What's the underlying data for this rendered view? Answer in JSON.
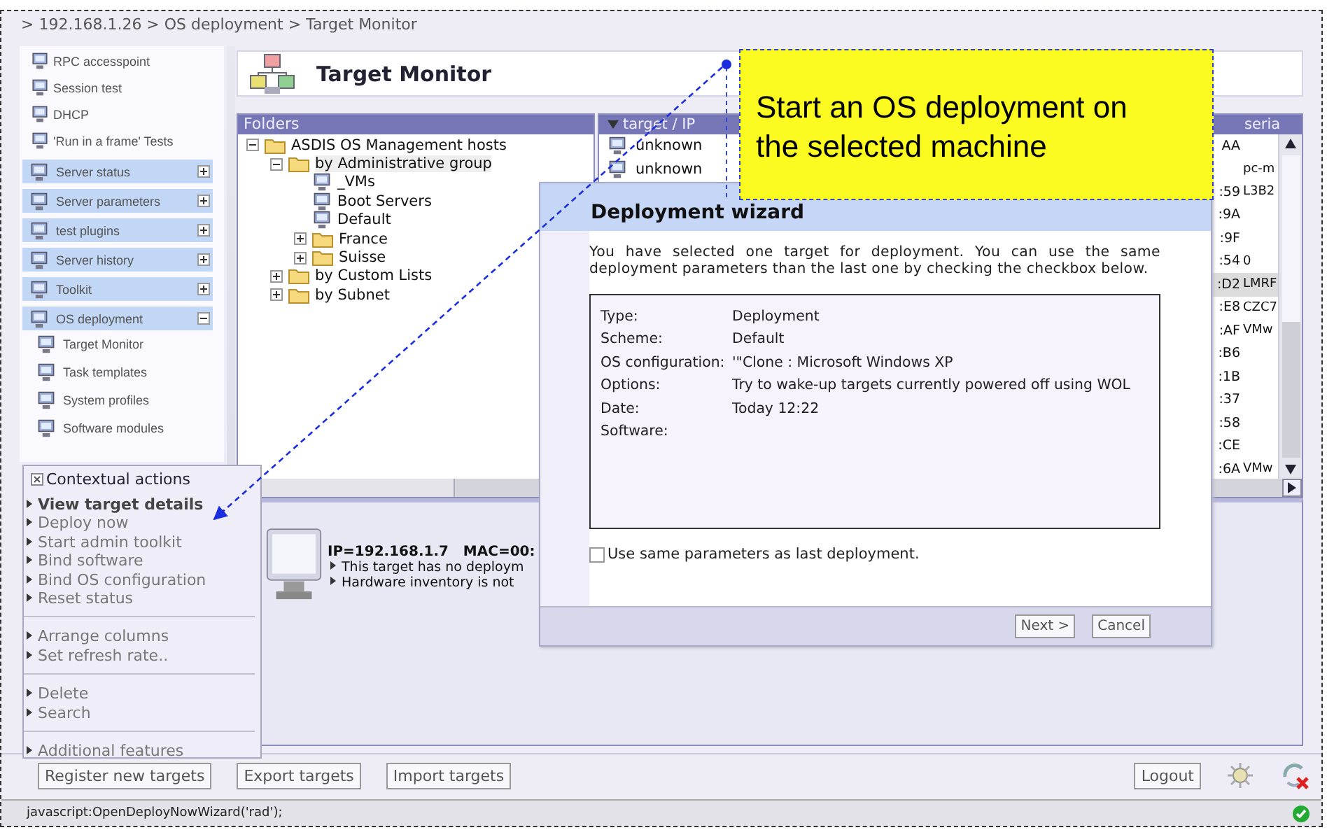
{
  "breadcrumb": "> 192.168.1.26 > OS deployment > Target Monitor",
  "sidebar": {
    "links": [
      "RPC accesspoint",
      "Session test",
      "DHCP",
      "'Run in a frame' Tests"
    ],
    "sections": [
      {
        "label": "Server status",
        "expanded": false
      },
      {
        "label": "Server parameters",
        "expanded": false
      },
      {
        "label": "test plugins",
        "expanded": false
      },
      {
        "label": "Server history",
        "expanded": false
      },
      {
        "label": "Toolkit",
        "expanded": false
      },
      {
        "label": "OS deployment",
        "expanded": true,
        "children": [
          "Target Monitor",
          "Task templates",
          "System profiles",
          "Software modules"
        ]
      }
    ]
  },
  "page_title": "Target Monitor",
  "folders": {
    "title": "Folders",
    "tree": [
      {
        "label": "ASDIS OS Management hosts",
        "kind": "folder",
        "expanded": true,
        "children": [
          {
            "label": "by Administrative group",
            "kind": "folder",
            "expanded": true,
            "selected": true,
            "children": [
              {
                "label": "_VMs",
                "kind": "group"
              },
              {
                "label": "Boot Servers",
                "kind": "group"
              },
              {
                "label": "Default",
                "kind": "group"
              },
              {
                "label": "France",
                "kind": "folder",
                "expanded": false
              },
              {
                "label": "Suisse",
                "kind": "folder",
                "expanded": false
              }
            ]
          },
          {
            "label": "by Custom Lists",
            "kind": "folder",
            "expanded": false
          },
          {
            "label": "by Subnet",
            "kind": "folder",
            "expanded": false
          }
        ]
      }
    ]
  },
  "targets": {
    "columns": [
      "target / IP",
      "seria"
    ],
    "rows": [
      {
        "target": "unknown",
        "mac": "AA",
        "selected": false
      },
      {
        "target": "unknown",
        "serial": "pc-m",
        "selected": false
      },
      {
        "mac": ":59",
        "serial": "L3B2",
        "selected": false
      },
      {
        "mac": ":9A",
        "selected": false
      },
      {
        "mac": ":9F",
        "selected": false
      },
      {
        "mac": ":54",
        "serial": "0",
        "selected": false
      },
      {
        "mac": ":D2",
        "serial": "LMRF",
        "selected": true
      },
      {
        "mac": ":E8",
        "serial": "CZC7",
        "selected": false
      },
      {
        "mac": ":AF",
        "serial": "VMw",
        "selected": false
      },
      {
        "mac": ":B6",
        "selected": false
      },
      {
        "mac": ":1B",
        "selected": false
      },
      {
        "mac": ":37",
        "selected": false
      },
      {
        "mac": ":58",
        "selected": false
      },
      {
        "mac": ":CE",
        "selected": false
      },
      {
        "mac": ":6A",
        "serial": "VMw",
        "selected": false
      }
    ]
  },
  "details": {
    "heading": "IP=192.168.1.7   MAC=00:",
    "lines": [
      "This target has no deploym",
      "Hardware inventory is not"
    ]
  },
  "context_menu": {
    "title": "Contextual actions",
    "groups": [
      [
        {
          "label": "View target details",
          "bold": true
        },
        {
          "label": "Deploy now",
          "bold": false
        },
        {
          "label": "Start admin toolkit",
          "bold": false
        },
        {
          "label": "Bind software",
          "bold": false
        },
        {
          "label": "Bind OS configuration",
          "bold": false
        },
        {
          "label": "Reset status",
          "bold": false
        }
      ],
      [
        {
          "label": "Arrange columns",
          "bold": false
        },
        {
          "label": "Set refresh rate..",
          "bold": false
        }
      ],
      [
        {
          "label": "Delete",
          "bold": false
        },
        {
          "label": "Search",
          "bold": false
        }
      ],
      [
        {
          "label": "Additional features",
          "bold": false
        }
      ]
    ]
  },
  "buttons": [
    "Register new targets",
    "Export targets",
    "Import targets"
  ],
  "logout": "Logout",
  "status_bar": "javascript:OpenDeployNowWizard('rad');",
  "dialog": {
    "title": "Deployment wizard",
    "message": "You have selected one target for deployment. You can use the same deployment parameters than the last one by checking the checkbox below.",
    "info": [
      {
        "label": "Type:",
        "value": "Deployment"
      },
      {
        "label": "Scheme:",
        "value": "Default"
      },
      {
        "label": "OS configuration:",
        "value": "'\"Clone : Microsoft Windows XP"
      },
      {
        "label": "Options:",
        "value": "Try to wake-up targets currently powered off using WOL"
      },
      {
        "label": "Date:",
        "value": "Today 12:22"
      },
      {
        "label": "Software:"
      }
    ],
    "checkbox": {
      "label": "Use same parameters as last deployment.",
      "checked": false
    },
    "buttons": [
      "Next >",
      "Cancel"
    ]
  },
  "callout": {
    "text": "Start an OS deployment on the selected machine"
  }
}
